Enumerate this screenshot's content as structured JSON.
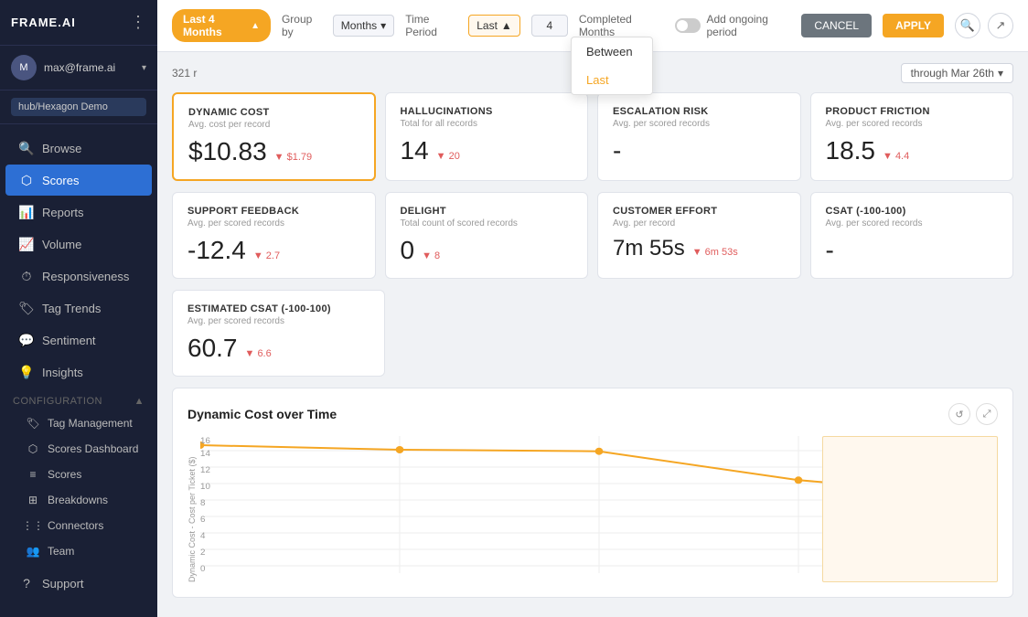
{
  "sidebar": {
    "brand": "FRAME.AI",
    "user": {
      "name": "max@frame.ai",
      "initials": "M"
    },
    "workspace": "hub/Hexagon Demo",
    "nav": [
      {
        "id": "browse",
        "label": "Browse",
        "icon": "🔍"
      },
      {
        "id": "scores",
        "label": "Scores",
        "icon": "⬡",
        "active": true
      },
      {
        "id": "reports",
        "label": "Reports",
        "icon": "📊"
      },
      {
        "id": "volume",
        "label": "Volume",
        "icon": "📈"
      },
      {
        "id": "responsiveness",
        "label": "Responsiveness",
        "icon": "⏱"
      },
      {
        "id": "tag-trends",
        "label": "Tag Trends",
        "icon": "🏷"
      },
      {
        "id": "sentiment",
        "label": "Sentiment",
        "icon": "💬"
      },
      {
        "id": "insights",
        "label": "Insights",
        "icon": "💡"
      }
    ],
    "config_section": "Configuration",
    "config_items": [
      {
        "id": "tag-management",
        "label": "Tag Management",
        "icon": "🏷"
      },
      {
        "id": "scores-dashboard",
        "label": "Scores Dashboard",
        "icon": "⬡"
      },
      {
        "id": "scores-config",
        "label": "Scores",
        "icon": "≡"
      },
      {
        "id": "breakdowns",
        "label": "Breakdowns",
        "icon": "⊞"
      },
      {
        "id": "connectors",
        "label": "Connectors",
        "icon": "⋮⋮⋮"
      },
      {
        "id": "team",
        "label": "Team",
        "icon": "👥"
      }
    ],
    "support": "Support"
  },
  "topbar": {
    "filter_pill": "Last 4 Months",
    "group_by_label": "Group by",
    "group_by_value": "Months",
    "time_period_label": "Time Period",
    "time_period_value": "Last",
    "period_number": "4",
    "period_unit": "Completed Months",
    "add_ongoing_label": "Add ongoing period",
    "cancel_label": "CANCEL",
    "apply_label": "APPLY",
    "date_range": "through Mar 26th",
    "record_count": "321 r"
  },
  "dropdown": {
    "items": [
      {
        "id": "between",
        "label": "Between",
        "selected": false
      },
      {
        "id": "last",
        "label": "Last",
        "selected": true
      }
    ]
  },
  "cards": [
    {
      "id": "dynamic-cost",
      "title": "DYNAMIC COST",
      "subtitle": "Avg. cost per record",
      "value": "$10.83",
      "change": "▼ $1.79",
      "change_type": "negative",
      "highlighted": true
    },
    {
      "id": "hallucinations",
      "title": "HALLUCINATIONS",
      "subtitle": "Total for all records",
      "value": "14",
      "change": "▼ 20",
      "change_type": "negative",
      "highlighted": false
    },
    {
      "id": "escalation-risk",
      "title": "ESCALATION RISK",
      "subtitle": "Avg. per scored records",
      "value": "-",
      "change": "",
      "change_type": "",
      "highlighted": false
    },
    {
      "id": "product-friction",
      "title": "PRODUCT FRICTION",
      "subtitle": "Avg. per scored records",
      "value": "18.5",
      "change": "▼ 4.4",
      "change_type": "negative",
      "highlighted": false
    },
    {
      "id": "support-feedback",
      "title": "SUPPORT FEEDBACK",
      "subtitle": "Avg. per scored records",
      "value": "-12.4",
      "change": "▼ 2.7",
      "change_type": "negative",
      "highlighted": false
    },
    {
      "id": "delight",
      "title": "DELIGHT",
      "subtitle": "Total count of scored records",
      "value": "0",
      "change": "▼ 8",
      "change_type": "negative",
      "highlighted": false
    },
    {
      "id": "customer-effort",
      "title": "CUSTOMER EFFORT",
      "subtitle": "Avg. per record",
      "value": "7m 55s",
      "change": "▼ 6m 53s",
      "change_type": "negative",
      "highlighted": false
    },
    {
      "id": "csat",
      "title": "CSAT (-100-100)",
      "subtitle": "Avg. per scored records",
      "value": "-",
      "change": "",
      "change_type": "",
      "highlighted": false
    }
  ],
  "estimated_csat": {
    "id": "estimated-csat",
    "title": "ESTIMATED CSAT (-100-100)",
    "subtitle": "Avg. per scored records",
    "value": "60.7",
    "change": "▼ 6.6",
    "change_type": "negative"
  },
  "chart": {
    "title": "Dynamic Cost over Time",
    "y_label": "Dynamic Cost - Cost per Ticket ($)",
    "data_points": [
      16.8,
      16.2,
      16.0,
      12.2,
      10.5
    ],
    "x_labels": [
      "",
      "",
      "",
      "",
      ""
    ],
    "y_max": 18,
    "y_min": 0,
    "icon_refresh": "↺",
    "icon_expand": "⤢"
  }
}
